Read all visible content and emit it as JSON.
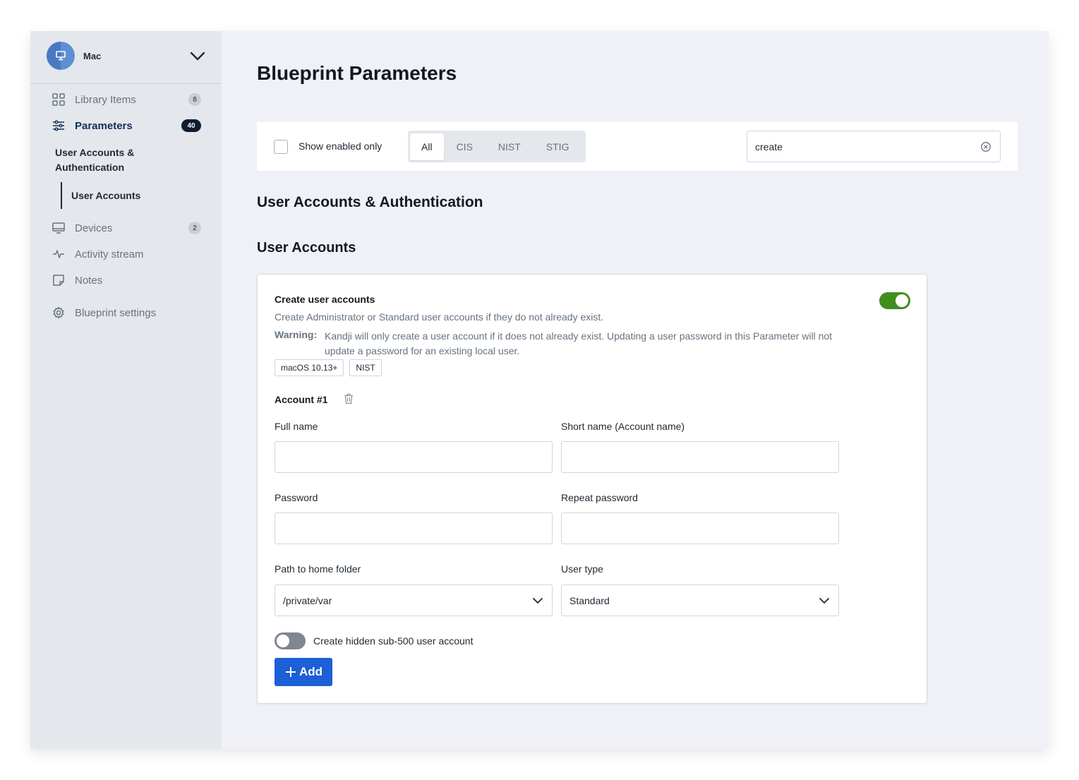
{
  "sidebar": {
    "title": "Mac",
    "items": [
      {
        "label": "Library Items",
        "count": "8"
      },
      {
        "label": "Parameters",
        "count": "40"
      },
      {
        "label": "Devices",
        "count": "2"
      },
      {
        "label": "Activity stream"
      },
      {
        "label": "Notes"
      },
      {
        "label": "Blueprint settings"
      }
    ],
    "sub_group": "User Accounts & Authentication",
    "sub_item": "User Accounts"
  },
  "main": {
    "title": "Blueprint Parameters",
    "filter": {
      "checkbox_label": "Show enabled only",
      "tabs": [
        "All",
        "CIS",
        "NIST",
        "STIG"
      ],
      "active_tab": "All",
      "search_value": "create"
    },
    "section_title": "User Accounts & Authentication",
    "subsection_title": "User Accounts",
    "card": {
      "title": "Create user accounts",
      "description": "Create Administrator or Standard user accounts if they do not already exist.",
      "warning_label": "Warning:",
      "warning_text": "Kandji will only create a user account if it does not already exist. Updating a user password in this Parameter will not update a password for an existing local user.",
      "tags": [
        "macOS 10.13+",
        "NIST"
      ],
      "enabled": true,
      "account_title": "Account #1",
      "fields": {
        "full_name": {
          "label": "Full name",
          "value": ""
        },
        "short_name": {
          "label": "Short name (Account name)",
          "value": ""
        },
        "password": {
          "label": "Password",
          "value": ""
        },
        "repeat_password": {
          "label": "Repeat password",
          "value": ""
        },
        "home_folder": {
          "label": "Path to home folder",
          "value": "/private/var"
        },
        "user_type": {
          "label": "User type",
          "value": "Standard"
        }
      },
      "hidden_toggle_label": "Create hidden sub-500 user account",
      "hidden_toggle_on": false,
      "add_label": "Add"
    }
  },
  "colors": {
    "accent": "#1c5fd6",
    "toggle_on": "#3f8f1f",
    "sidebar_bg": "#e4e7ec",
    "main_bg": "#eff1f6"
  }
}
